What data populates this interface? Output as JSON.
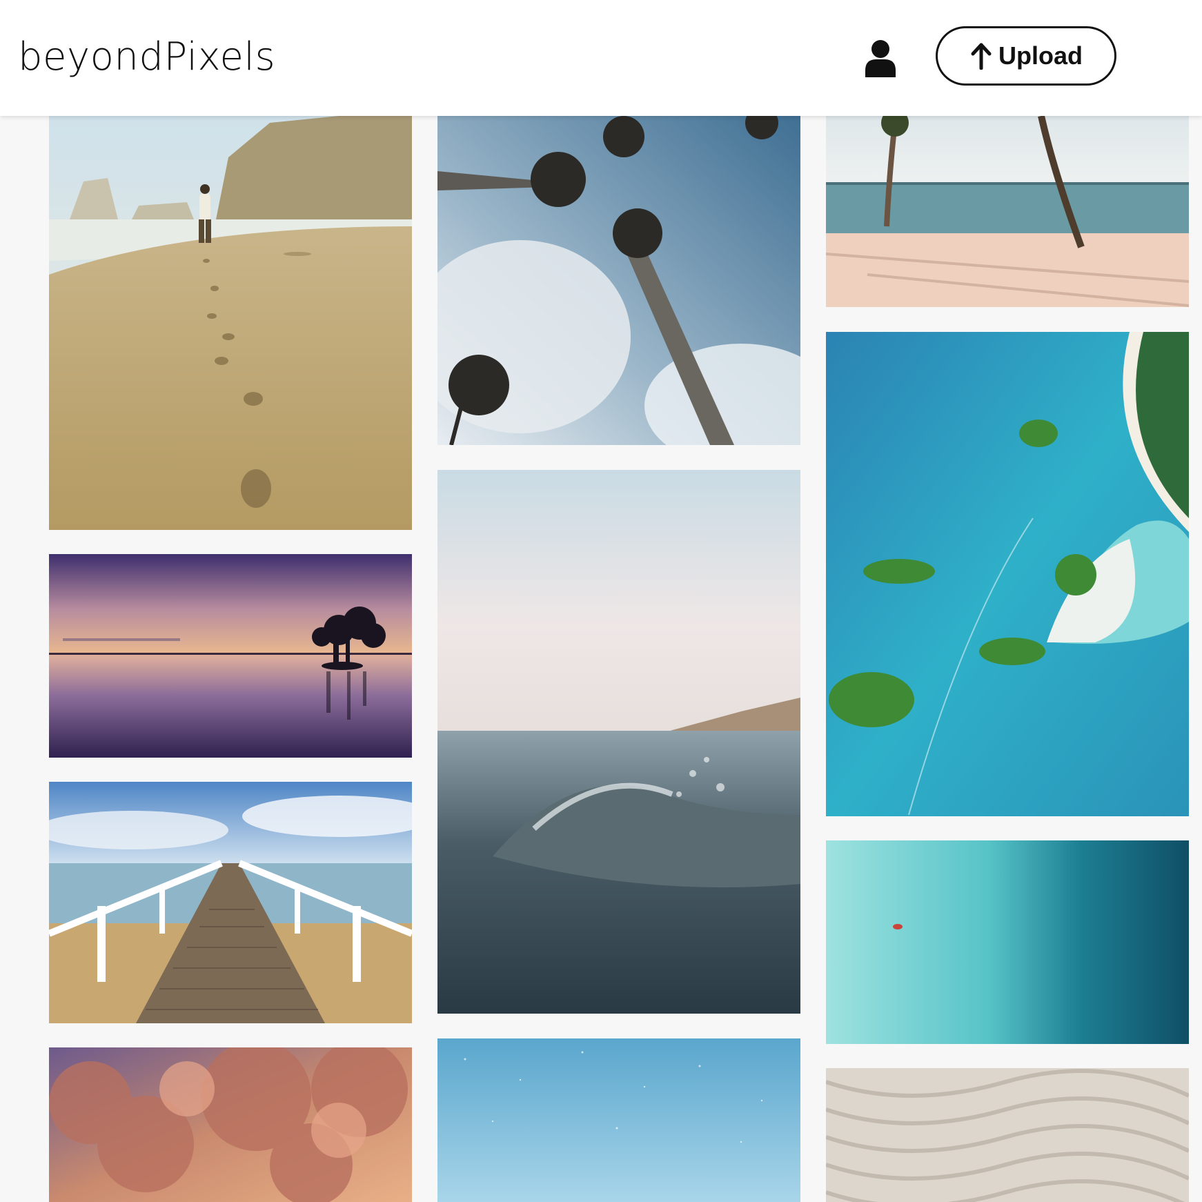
{
  "header": {
    "logo": "beyondPixels",
    "upload_label": "Upload",
    "user_icon": "user-icon",
    "upload_icon": "arrow-up-icon"
  },
  "gallery": {
    "columns": [
      {
        "photos": [
          "beach-footprints",
          "mangrove-sunset",
          "wooden-pier",
          "sunset-clouds"
        ]
      },
      {
        "photos": [
          "palm-trees-sky",
          "ocean-wave",
          "starry-sky"
        ]
      },
      {
        "photos": [
          "palm-beach",
          "aerial-islands",
          "aerial-turquoise-water",
          "sand-ripples"
        ]
      }
    ]
  },
  "colors": {
    "background": "#f7f7f7",
    "header": "#ffffff",
    "text": "#111111"
  }
}
